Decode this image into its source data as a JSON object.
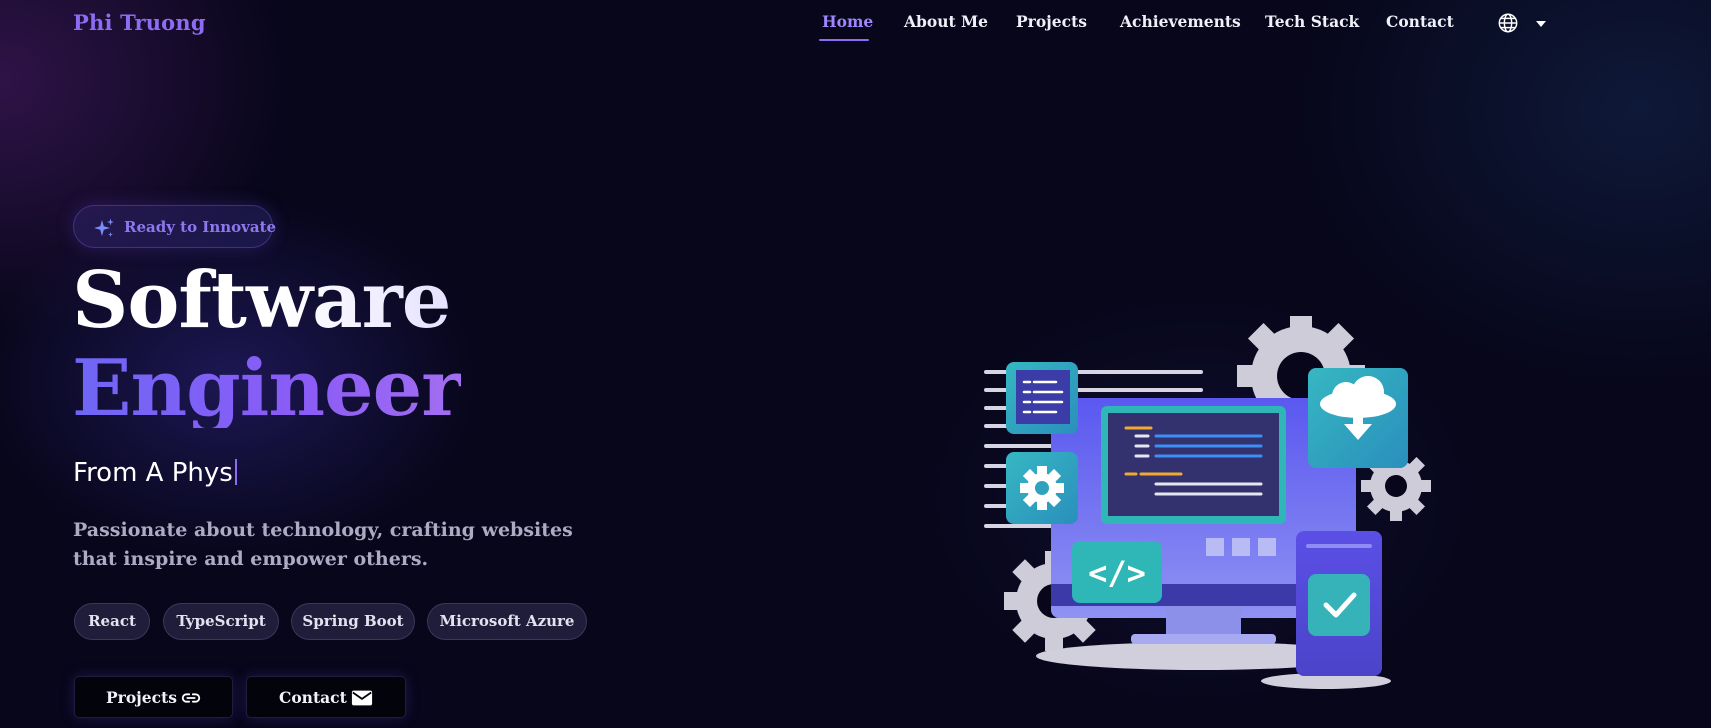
{
  "brand": "Phi Truong",
  "nav": {
    "items": [
      {
        "label": "Home",
        "active": true
      },
      {
        "label": "About Me"
      },
      {
        "label": "Projects"
      },
      {
        "label": "Achievements"
      },
      {
        "label": "Tech Stack"
      },
      {
        "label": "Contact"
      }
    ],
    "language_icon": "globe-icon"
  },
  "hero": {
    "badge": "Ready to Innovate",
    "title_line1": "Software",
    "title_line2": "Engineer",
    "typing_text": "From A Phys",
    "description": "Passionate about technology, crafting websites that inspire and empower others.",
    "tags": [
      "React",
      "TypeScript",
      "Spring Boot",
      "Microsoft Azure"
    ],
    "buttons": {
      "projects": "Projects",
      "contact": "Contact"
    }
  },
  "colors": {
    "background": "#07061a",
    "accent": "#8b6cf2",
    "gradient_start": "#6f66f5",
    "gradient_end": "#a36ef0"
  }
}
